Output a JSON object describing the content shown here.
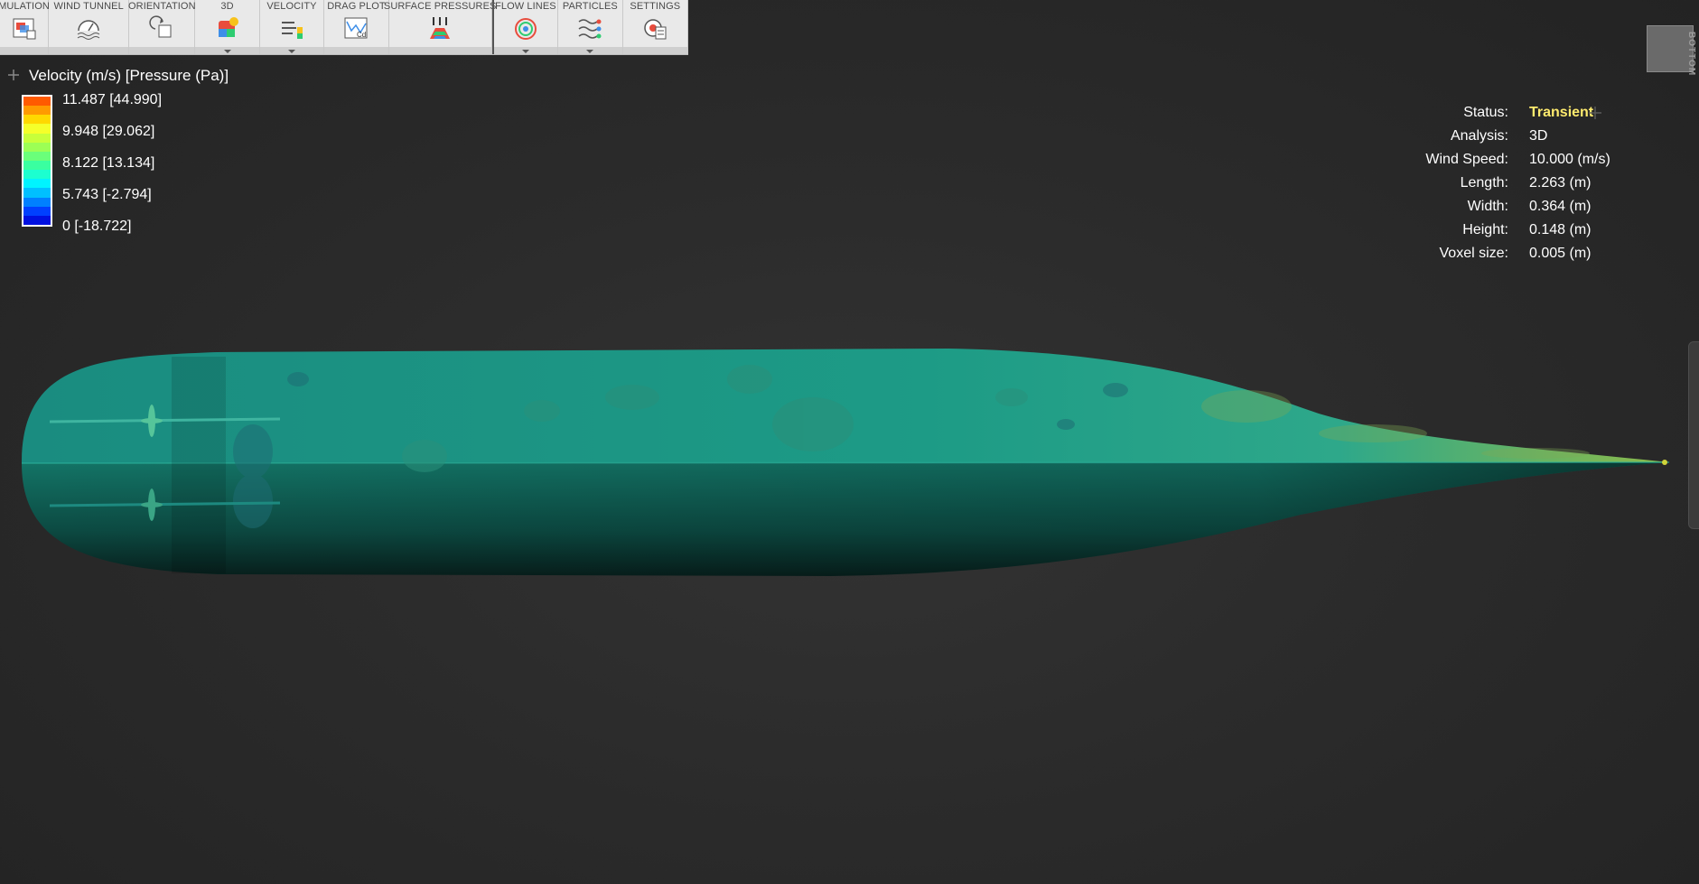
{
  "toolbar": {
    "groups": [
      {
        "label": "MULATION",
        "icon": "simulation-icon"
      },
      {
        "label": "WIND TUNNEL",
        "icon": "wind-tunnel-icon"
      },
      {
        "label": "ORIENTATION",
        "icon": "orientation-icon"
      },
      {
        "label": "3D",
        "icon": "3d-icon"
      },
      {
        "label": "VELOCITY",
        "icon": "velocity-icon"
      },
      {
        "label": "DRAG PLOT",
        "icon": "drag-plot-icon"
      },
      {
        "label": "SURFACE PRESSURES",
        "icon": "surface-pressures-icon"
      },
      {
        "label": "FLOW LINES",
        "icon": "flow-lines-icon"
      },
      {
        "label": "PARTICLES",
        "icon": "particles-icon"
      },
      {
        "label": "SETTINGS",
        "icon": "settings-icon"
      }
    ]
  },
  "legend": {
    "title": "Velocity (m/s) [Pressure (Pa)]",
    "ticks": [
      "11.487 [44.990]",
      "9.948 [29.062]",
      "8.122 [13.134]",
      "5.743 [-2.794]",
      "0 [-18.722]"
    ],
    "colors": [
      "#ff5a00",
      "#ff9a00",
      "#ffd800",
      "#f5ff2a",
      "#c8ff3a",
      "#9cff55",
      "#6aff7a",
      "#3affa0",
      "#1cffd0",
      "#00f4ff",
      "#00c0ff",
      "#0080ff",
      "#0040ff",
      "#0010e0"
    ]
  },
  "info": {
    "status_label": "Status:",
    "status_value": "Transient",
    "analysis_label": "Analysis:",
    "analysis_value": "3D",
    "wind_speed_label": "Wind Speed:",
    "wind_speed_value": "10.000 (m/s)",
    "length_label": "Length:",
    "length_value": "2.263 (m)",
    "width_label": "Width:",
    "width_value": "0.364 (m)",
    "height_label": "Height:",
    "height_value": "0.148 (m)",
    "voxel_label": "Voxel size:",
    "voxel_value": "0.005 (m)"
  },
  "viewcube": {
    "face": "BOTTOM"
  },
  "colors": {
    "status": "#ffeb6e",
    "model_teal": "#1fa08a",
    "toolbar_bg": "#e9e9e9"
  }
}
